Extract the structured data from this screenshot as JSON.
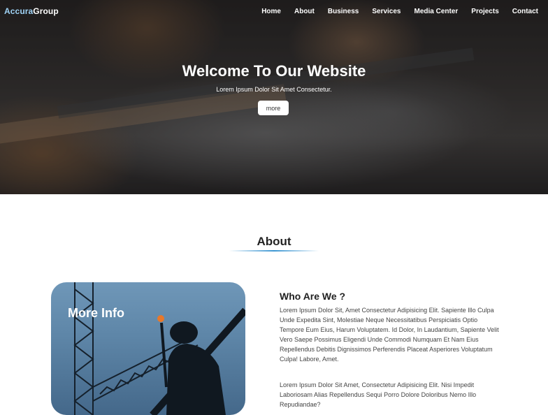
{
  "brand": {
    "logo_part1": "Accura",
    "logo_part2": "Group",
    "accent": "#9fd2f5"
  },
  "nav": {
    "items": [
      "Home",
      "About",
      "Business",
      "Services",
      "Media Center",
      "Projects",
      "Contact"
    ]
  },
  "hero": {
    "title": "Welcome To Our Website",
    "subtitle": "Lorem Ipsum Dolor Sit Amet Consectetur.",
    "button": "more"
  },
  "about": {
    "heading": "About",
    "card_label": "More Info",
    "who_title": "Who Are We ?",
    "paragraph1": "Lorem Ipsum Dolor Sit, Amet Consectetur Adipisicing Elit. Sapiente Illo Culpa Unde Expedita Sint, Molestiae Neque Necessitatibus Perspiciatis Optio Tempore Eum Eius, Harum Voluptatem. Id Dolor, In Laudantium, Sapiente Velit Vero Saepe Possimus Eligendi Unde Commodi Numquam Et Nam Eius Repellendus Debitis Dignissimos Perferendis Placeat Asperiores Voluptatum Culpa! Labore, Amet.",
    "paragraph2": "Lorem Ipsum Dolor Sit Amet, Consectetur Adipisicing Elit. Nisi Impedit Laboriosam Alias Repellendus Sequi Porro Dolore Doloribus Nemo Illo Repudiandae?"
  }
}
